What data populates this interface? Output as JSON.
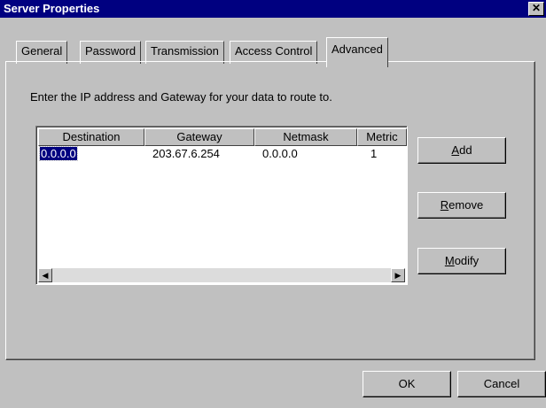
{
  "window": {
    "title": "Server Properties",
    "close_glyph": "✕"
  },
  "tabs": [
    {
      "label": "General"
    },
    {
      "label": "Password"
    },
    {
      "label": "Transmission"
    },
    {
      "label": "Access Control"
    },
    {
      "label": "Advanced",
      "active": true
    }
  ],
  "instruction": "Enter the IP address and Gateway for your data to route to.",
  "routes_table": {
    "columns": [
      "Destination",
      "Gateway",
      "Netmask",
      "Metric"
    ],
    "rows": [
      {
        "destination": "0.0.0.0",
        "gateway": "203.67.6.254",
        "netmask": "0.0.0.0",
        "metric": "1",
        "selected": true
      }
    ]
  },
  "side_buttons": {
    "add": {
      "mnemonic": "A",
      "rest": "dd"
    },
    "remove": {
      "mnemonic": "R",
      "rest": "emove"
    },
    "modify": {
      "mnemonic": "M",
      "rest": "odify"
    }
  },
  "footer": {
    "ok_label": "OK",
    "cancel_label": "Cancel"
  },
  "scroll_icons": {
    "left": "left-arrow-icon",
    "right": "right-arrow-icon"
  }
}
